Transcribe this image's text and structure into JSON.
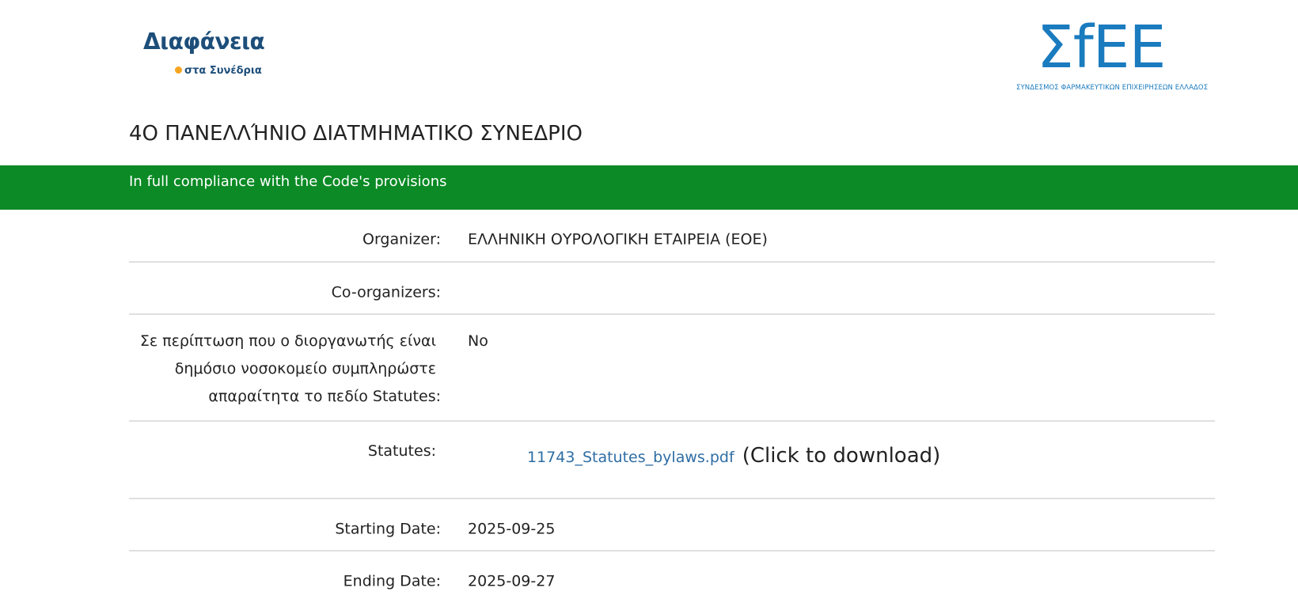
{
  "logos": {
    "left_main": "Διαφάνεια",
    "left_sub": "στα Συνέδρια",
    "right_main": "ΣfΕΕ",
    "right_tagline": "ΣΥΝΔΕΣΜΟΣ ΦΑΡΜΑΚΕΥΤΙΚΩΝ ΕΠΙΧΕΙΡΗΣΕΩΝ ΕΛΛΑΔΟΣ"
  },
  "page": {
    "title": "4Ο ΠΑΝΕΛΛΉΝΙΟ ΔΙΑΤΜΗΜΑΤΙΚΟ ΣΥΝΕΔΡΙΟ",
    "banner": "In full compliance with the Code's provisions",
    "banner_color": "#0b8a25"
  },
  "details": {
    "organizer_label": "Organizer:",
    "organizer_value": "ΕΛΛΗΝΙΚΗ ΟΥΡΟΛΟΓΙΚΗ ΕΤΑΙΡΕΙΑ (ΕΟΕ)",
    "coorganizers_label": "Co-organizers:",
    "coorganizers_value": "",
    "hospital_label_line1": "Σε περίπτωση που ο διοργανωτής είναι",
    "hospital_label_line2": "δημόσιο νοσοκομείο συμπληρώστε",
    "hospital_label_line3": "απαραίτητα το πεδίο Statutes:",
    "hospital_value": "No",
    "statutes_label": "Statutes:",
    "statutes_file": "11743_Statutes_bylaws.pdf",
    "statutes_hint": "(Click to download)",
    "start_label": "Starting Date:",
    "start_value": "2025-09-25",
    "end_label": "Ending Date:",
    "end_value": "2025-09-27"
  }
}
